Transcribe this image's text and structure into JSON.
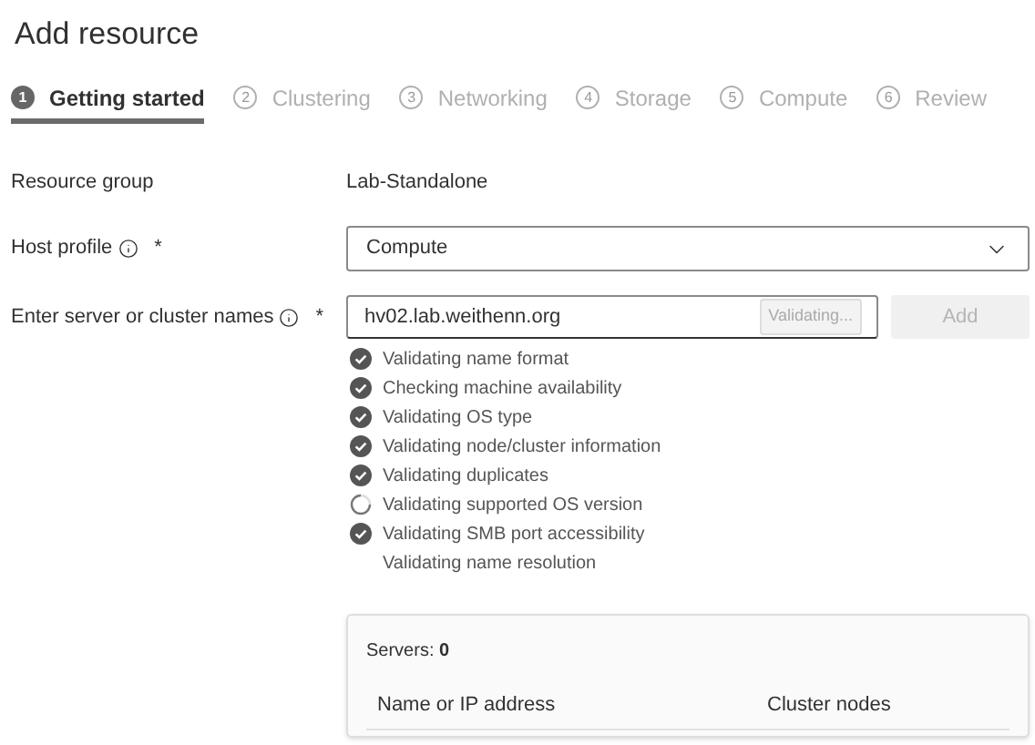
{
  "title": "Add resource",
  "steps": [
    {
      "number": "1",
      "label": "Getting started",
      "selected": true
    },
    {
      "number": "2",
      "label": "Clustering",
      "selected": false
    },
    {
      "number": "3",
      "label": "Networking",
      "selected": false
    },
    {
      "number": "4",
      "label": "Storage",
      "selected": false
    },
    {
      "number": "5",
      "label": "Compute",
      "selected": false
    },
    {
      "number": "6",
      "label": "Review",
      "selected": false
    }
  ],
  "resource_group": {
    "label": "Resource group",
    "value": "Lab-Standalone"
  },
  "host_profile": {
    "label": "Host profile",
    "required_mark": "*",
    "value": "Compute"
  },
  "server_names": {
    "label": "Enter server or cluster names",
    "required_mark": "*",
    "value": "hv02.lab.weithenn.org",
    "status_button": "Validating...",
    "add_button": "Add",
    "add_disabled": true
  },
  "checks": [
    {
      "text": "Validating name format",
      "kind": "done"
    },
    {
      "text": "Checking machine availability",
      "kind": "done"
    },
    {
      "text": "Validating OS type",
      "kind": "done"
    },
    {
      "text": "Validating node/cluster information",
      "kind": "done"
    },
    {
      "text": "Validating duplicates",
      "kind": "done"
    },
    {
      "text": "Validating supported OS version",
      "kind": "running"
    },
    {
      "text": "Validating SMB port accessibility",
      "kind": "done"
    },
    {
      "text": "Validating name resolution",
      "kind": "waiting"
    }
  ],
  "servers": {
    "count_label": "Servers: **0**",
    "columns": [
      "Name or IP address",
      "Cluster nodes"
    ]
  }
}
